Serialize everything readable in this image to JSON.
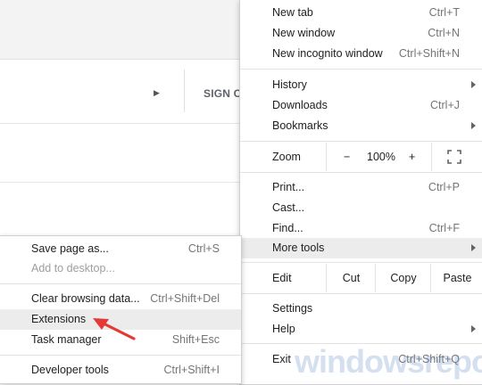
{
  "background": {
    "signin_label": "SIGN C"
  },
  "main_menu": {
    "items_top": [
      {
        "label": "New tab",
        "shortcut": "Ctrl+T"
      },
      {
        "label": "New window",
        "shortcut": "Ctrl+N"
      },
      {
        "label": "New incognito window",
        "shortcut": "Ctrl+Shift+N"
      }
    ],
    "history": {
      "label": "History"
    },
    "downloads": {
      "label": "Downloads",
      "shortcut": "Ctrl+J"
    },
    "bookmarks": {
      "label": "Bookmarks"
    },
    "zoom": {
      "label": "Zoom",
      "minus": "−",
      "value": "100%",
      "plus": "+"
    },
    "print": {
      "label": "Print...",
      "shortcut": "Ctrl+P"
    },
    "cast": {
      "label": "Cast..."
    },
    "find": {
      "label": "Find...",
      "shortcut": "Ctrl+F"
    },
    "more_tools": {
      "label": "More tools"
    },
    "edit": {
      "label": "Edit",
      "cut": "Cut",
      "copy": "Copy",
      "paste": "Paste"
    },
    "settings": {
      "label": "Settings"
    },
    "help": {
      "label": "Help"
    },
    "exit": {
      "label": "Exit",
      "shortcut": "Ctrl+Shift+Q"
    }
  },
  "sub_menu": {
    "save_page": {
      "label": "Save page as...",
      "shortcut": "Ctrl+S"
    },
    "add_desktop": {
      "label": "Add to desktop..."
    },
    "clear_data": {
      "label": "Clear browsing data...",
      "shortcut": "Ctrl+Shift+Del"
    },
    "extensions": {
      "label": "Extensions"
    },
    "task_manager": {
      "label": "Task manager",
      "shortcut": "Shift+Esc"
    },
    "dev_tools": {
      "label": "Developer tools",
      "shortcut": "Ctrl+Shift+I"
    }
  },
  "watermark": "windowsreport",
  "colors": {
    "accent_arrow": "#e53935",
    "hover": "#ececec"
  }
}
